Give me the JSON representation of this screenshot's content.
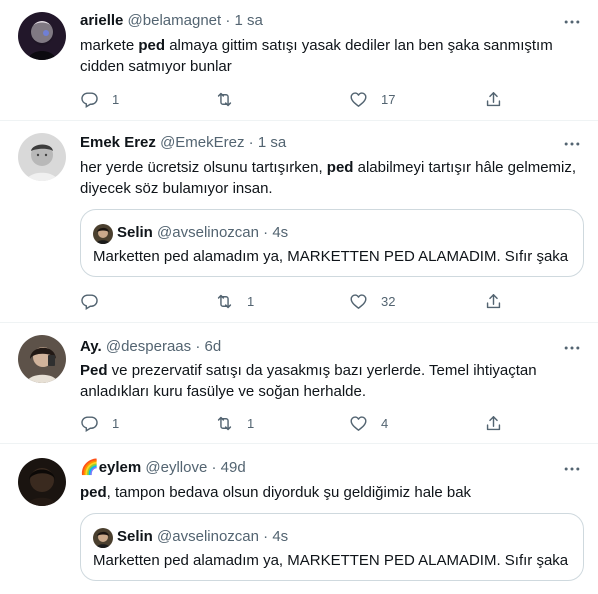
{
  "tweets": [
    {
      "name": "arielle",
      "handle": "@belamagnet",
      "sep": "·",
      "time": "1 sa",
      "text_before": "markete ",
      "text_bold": "ped",
      "text_after": " almaya gittim satışı yasak dediler lan ben şaka sanmıştım cidden satmıyor bunlar",
      "reply_count": "1",
      "retweet_count": "",
      "like_count": "17"
    },
    {
      "name": "Emek Erez",
      "handle": "@EmekErez",
      "sep": "·",
      "time": "1 sa",
      "text_before": "her yerde ücretsiz olsunu tartışırken, ",
      "text_bold": "ped",
      "text_after": " alabilmeyi tartışır hâle gelmemiz, diyecek söz bulamıyor insan.",
      "quote": {
        "name": "Selin",
        "handle": "@avselinozcan",
        "sep": "·",
        "time": "4s",
        "text": "Marketten ped alamadım ya, MARKETTEN PED ALAMADIM. Sıfır şaka"
      },
      "reply_count": "",
      "retweet_count": "1",
      "like_count": "32"
    },
    {
      "name": "Ay.",
      "handle": "@desperaas",
      "sep": "·",
      "time": "6d",
      "text_before": "",
      "text_bold": "Ped",
      "text_after": " ve prezervatif satışı da yasakmış bazı yerlerde. Temel ihtiyaçtan anladıkları kuru fasülye ve soğan herhalde.",
      "reply_count": "1",
      "retweet_count": "1",
      "like_count": "4"
    },
    {
      "name": "eylem",
      "name_emoji": "🌈",
      "handle": "@eyllove",
      "sep": "·",
      "time": "49d",
      "text_before": "",
      "text_bold": "ped",
      "text_after": ", tampon bedava olsun diyorduk şu geldiğimiz hale bak",
      "quote": {
        "name": "Selin",
        "handle": "@avselinozcan",
        "sep": "·",
        "time": "4s",
        "text": "Marketten ped alamadım ya, MARKETTEN PED ALAMADIM. Sıfır şaka"
      }
    }
  ],
  "colors": {
    "text": "#0f1419",
    "secondary": "#536471",
    "border": "#cfd9de",
    "divider": "#eff3f4"
  },
  "icons": {
    "reply": "reply-icon",
    "retweet": "retweet-icon",
    "like": "heart-icon",
    "share": "share-icon",
    "more": "more-icon"
  }
}
